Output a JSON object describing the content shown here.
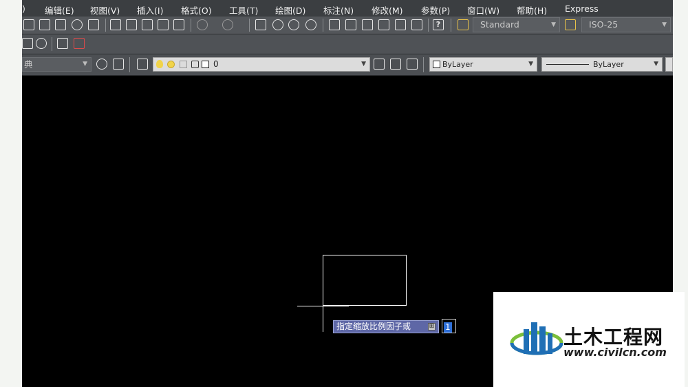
{
  "menu": [
    {
      "id": "partial",
      "label": ")"
    },
    {
      "id": "edit",
      "label": "编辑(E)"
    },
    {
      "id": "view",
      "label": "视图(V)"
    },
    {
      "id": "insert",
      "label": "插入(I)"
    },
    {
      "id": "format",
      "label": "格式(O)"
    },
    {
      "id": "tools",
      "label": "工具(T)"
    },
    {
      "id": "draw",
      "label": "绘图(D)"
    },
    {
      "id": "dimension",
      "label": "标注(N)"
    },
    {
      "id": "modify",
      "label": "修改(M)"
    },
    {
      "id": "parametric",
      "label": "参数(P)"
    },
    {
      "id": "window",
      "label": "窗口(W)"
    },
    {
      "id": "help",
      "label": "帮助(H)"
    },
    {
      "id": "express",
      "label": "Express"
    }
  ],
  "toolbar": {
    "text_style": "Standard",
    "dim_style": "ISO-25",
    "help_icon_label": "?",
    "workspace_partial": "典",
    "layer_name": "0",
    "color": "ByLayer",
    "linetype": "ByLayer"
  },
  "canvas": {
    "prompt": "指定缩放比例因子或",
    "prompt_button": "⊞",
    "input_value": "1"
  },
  "watermark": {
    "title": "土木工程网",
    "url": "www.civilcn.com"
  },
  "colors": {
    "menubar": "#3b3e41",
    "toolbar": "#53565a",
    "canvas": "#000000",
    "tooltip": "#5e67a6",
    "input_highlight": "#2e6fd8",
    "logo_blue": "#1f6fb5",
    "logo_green": "#7bbf3a"
  }
}
